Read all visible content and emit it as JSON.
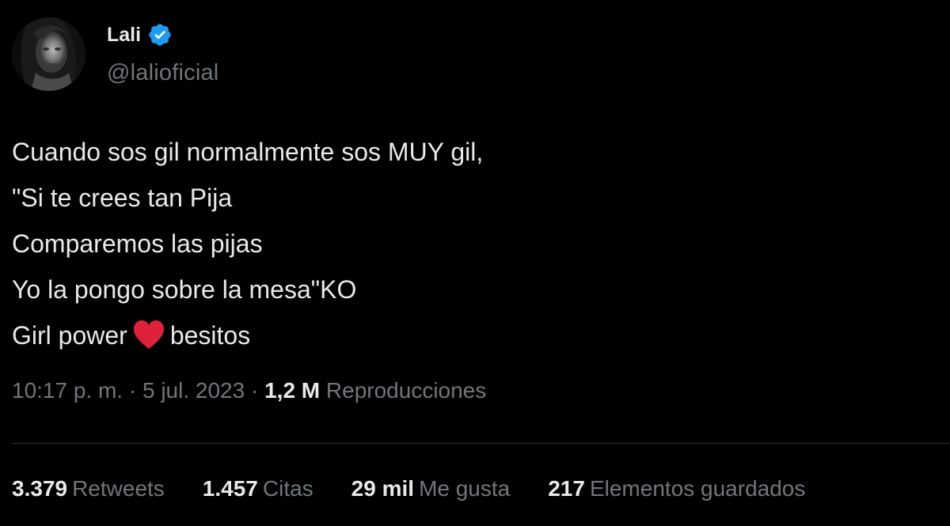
{
  "author": {
    "display_name": "Lali",
    "handle": "@lalioficial",
    "verified": true,
    "verified_color": "#1d9bf0"
  },
  "tweet": {
    "lines": [
      "Cuando sos gil normalmente sos MUY gil,",
      "\"Si te crees tan Pija",
      "Comparemos las pijas",
      "Yo la pongo sobre la mesa\"KO"
    ],
    "last_line_before_emoji": "Girl power",
    "emoji": "red-heart",
    "last_line_after_emoji": "besitos"
  },
  "meta": {
    "time": "10:17 p. m.",
    "separator": "·",
    "date": "5 jul. 2023",
    "views_count": "1,2 M",
    "views_label": "Reproducciones"
  },
  "stats": [
    {
      "count": "3.379",
      "label": "Retweets"
    },
    {
      "count": "1.457",
      "label": "Citas"
    },
    {
      "count": "29 mil",
      "label": "Me gusta"
    },
    {
      "count": "217",
      "label": "Elementos guardados"
    }
  ],
  "colors": {
    "background": "#000000",
    "primary_text": "#e7e9ea",
    "secondary_text": "#71767b",
    "divider": "#2f3336",
    "heart": "#e0213a"
  }
}
